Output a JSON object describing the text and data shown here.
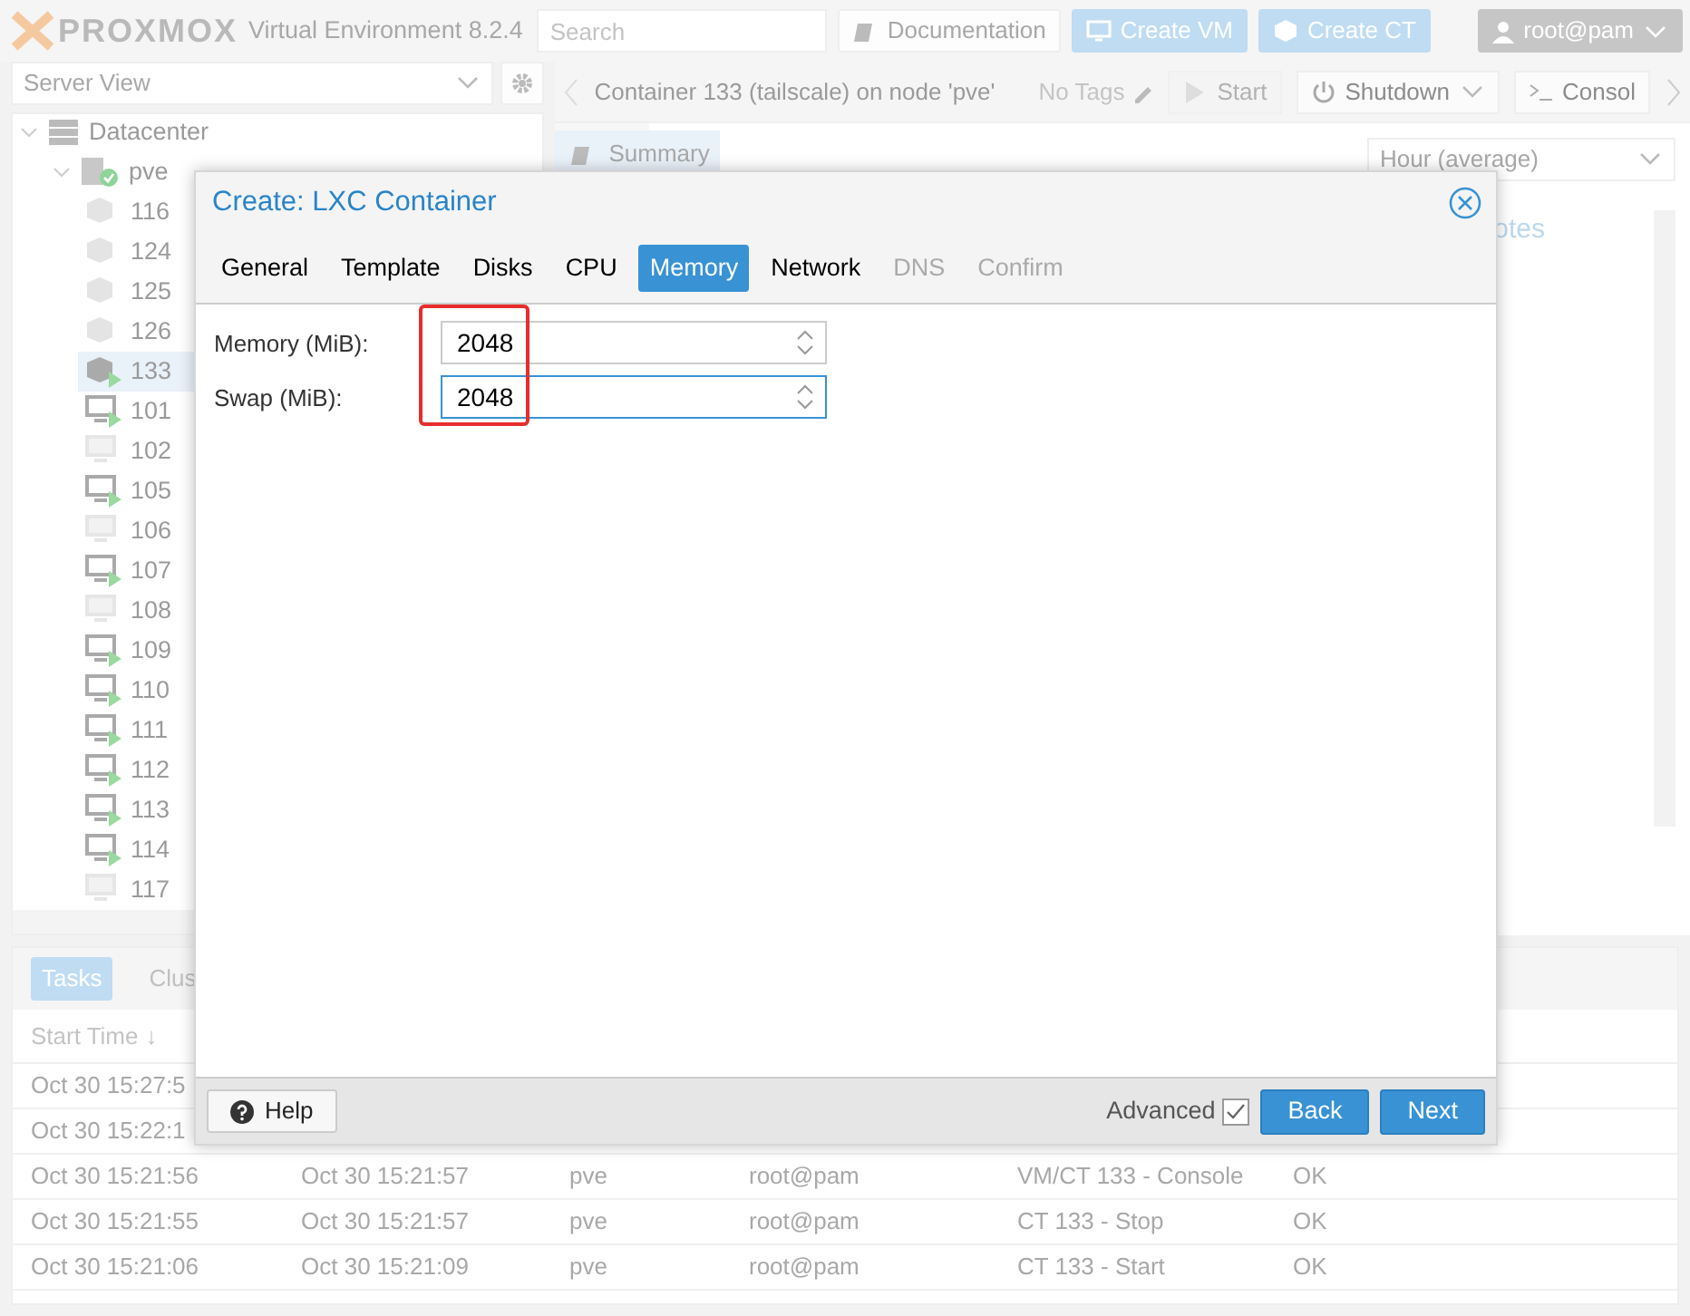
{
  "header": {
    "logo": "PROXMOX",
    "product": "Virtual Environment 8.2.4",
    "search": {
      "placeholder": "Search"
    },
    "buttons": [
      {
        "label": "Documentation",
        "kind": "docs"
      },
      {
        "label": "Create VM",
        "kind": "vm"
      },
      {
        "label": "Create CT",
        "kind": "ct"
      }
    ],
    "user": "root@pam"
  },
  "view_selector": "Server View",
  "tree": [
    {
      "label": "Datacenter",
      "kind": "datacenter",
      "expanded": true,
      "selected": false,
      "children": [
        {
          "label": "pve",
          "kind": "node",
          "expanded": true,
          "selected": false,
          "children": [
            {
              "label": "116",
              "kind": "ct",
              "running": false,
              "selected": false
            },
            {
              "label": "124",
              "kind": "ct",
              "running": false,
              "selected": false
            },
            {
              "label": "125",
              "kind": "ct",
              "running": false,
              "selected": false
            },
            {
              "label": "126",
              "kind": "ct",
              "running": false,
              "selected": false
            },
            {
              "label": "133",
              "kind": "ct",
              "running": true,
              "selected": true
            },
            {
              "label": "101",
              "kind": "vm",
              "running": true,
              "selected": false
            },
            {
              "label": "102",
              "kind": "vm",
              "running": false,
              "selected": false
            },
            {
              "label": "105",
              "kind": "vm",
              "running": true,
              "selected": false
            },
            {
              "label": "106",
              "kind": "vm",
              "running": false,
              "selected": false
            },
            {
              "label": "107",
              "kind": "vm",
              "running": true,
              "selected": false
            },
            {
              "label": "108",
              "kind": "vm",
              "running": false,
              "selected": false
            },
            {
              "label": "109",
              "kind": "vm",
              "running": true,
              "selected": false
            },
            {
              "label": "110",
              "kind": "vm",
              "running": true,
              "selected": false
            },
            {
              "label": "111",
              "kind": "vm",
              "running": true,
              "selected": false
            },
            {
              "label": "112",
              "kind": "vm",
              "running": true,
              "selected": false
            },
            {
              "label": "113",
              "kind": "vm",
              "running": true,
              "selected": false
            },
            {
              "label": "114",
              "kind": "vm",
              "running": true,
              "selected": false
            },
            {
              "label": "117",
              "kind": "vm",
              "running": false,
              "selected": false
            }
          ]
        }
      ]
    }
  ],
  "toolbar": {
    "title": "Container 133 (tailscale) on node 'pve'",
    "tags": "No Tags",
    "buttons": [
      {
        "label": "Start",
        "kind": "start",
        "disabled": true
      },
      {
        "label": "Shutdown",
        "kind": "shutdown",
        "disabled": false
      },
      {
        "label": "Consol",
        "kind": "console",
        "disabled": false
      }
    ]
  },
  "nav": [
    {
      "label": "Summary",
      "selected": true
    }
  ],
  "timeframe": "Hour (average)",
  "notes_tab": "otes",
  "dialog": {
    "title": "Create: LXC Container",
    "tabs": [
      {
        "label": "General",
        "selected": false,
        "disabled": false
      },
      {
        "label": "Template",
        "selected": false,
        "disabled": false
      },
      {
        "label": "Disks",
        "selected": false,
        "disabled": false
      },
      {
        "label": "CPU",
        "selected": false,
        "disabled": false
      },
      {
        "label": "Memory",
        "selected": true,
        "disabled": false
      },
      {
        "label": "Network",
        "selected": false,
        "disabled": false
      },
      {
        "label": "DNS",
        "selected": false,
        "disabled": true
      },
      {
        "label": "Confirm",
        "selected": false,
        "disabled": true
      }
    ],
    "fields": [
      {
        "label": "Memory (MiB):",
        "value": "2048",
        "focused": false
      },
      {
        "label": "Swap (MiB):",
        "value": "2048",
        "focused": true
      }
    ],
    "annotation": {
      "kind": "rectangle",
      "color": "#e82c2c"
    },
    "help": "Help",
    "advanced": {
      "label": "Advanced",
      "checked": true
    },
    "buttons": [
      "Back",
      "Next"
    ]
  },
  "tasks": {
    "tabs": [
      {
        "label": "Tasks",
        "selected": true
      },
      {
        "label": "Clus",
        "selected": false
      }
    ],
    "columns": [
      {
        "label": "Start Time",
        "sort_mark": "↓"
      }
    ],
    "rows": [
      [
        "Oct 30 15:27:5"
      ],
      [
        "Oct 30 15:22:1"
      ],
      [
        "Oct 30 15:21:56",
        "Oct 30 15:21:57",
        "pve",
        "root@pam",
        "VM/CT 133 - Console",
        "OK"
      ],
      [
        "Oct 30 15:21:55",
        "Oct 30 15:21:57",
        "pve",
        "root@pam",
        "CT 133 - Stop",
        "OK"
      ],
      [
        "Oct 30 15:21:06",
        "Oct 30 15:21:09",
        "pve",
        "root@pam",
        "CT 133 - Start",
        "OK"
      ]
    ]
  }
}
